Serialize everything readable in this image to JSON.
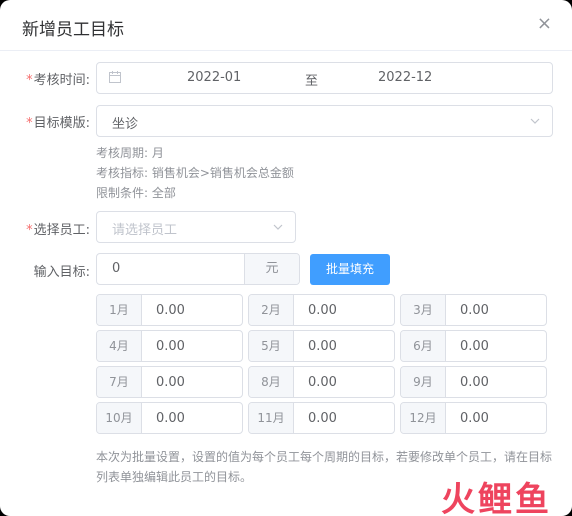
{
  "dialog": {
    "title": "新增员工目标",
    "close_symbol": "×"
  },
  "form": {
    "period": {
      "label": "考核时间:",
      "required_mark": "*",
      "start": "2022-01",
      "separator": "至",
      "end": "2022-12"
    },
    "template": {
      "label": "目标模版:",
      "required_mark": "*",
      "value": "坐诊"
    },
    "info": {
      "cycle_label": "考核周期:",
      "cycle_value": "月",
      "metric_label": "考核指标:",
      "metric_value": "销售机会>销售机会总金额",
      "limit_label": "限制条件:",
      "limit_value": "全部"
    },
    "employee": {
      "label": "选择员工:",
      "required_mark": "*",
      "placeholder": "请选择员工"
    },
    "target": {
      "label": "输入目标:",
      "value": "0",
      "unit": "元",
      "button": "批量填充"
    },
    "months": [
      {
        "label": "1月",
        "value": "0.00"
      },
      {
        "label": "2月",
        "value": "0.00"
      },
      {
        "label": "3月",
        "value": "0.00"
      },
      {
        "label": "4月",
        "value": "0.00"
      },
      {
        "label": "5月",
        "value": "0.00"
      },
      {
        "label": "6月",
        "value": "0.00"
      },
      {
        "label": "7月",
        "value": "0.00"
      },
      {
        "label": "8月",
        "value": "0.00"
      },
      {
        "label": "9月",
        "value": "0.00"
      },
      {
        "label": "10月",
        "value": "0.00"
      },
      {
        "label": "11月",
        "value": "0.00"
      },
      {
        "label": "12月",
        "value": "0.00"
      }
    ],
    "note": "本次为批量设置，设置的值为每个员工每个周期的目标，若要修改单个员工，请在目标列表单独编辑此员工的目标。"
  },
  "watermark": "火鲤鱼",
  "colors": {
    "primary": "#409eff",
    "required": "#f56c6c",
    "watermark": "#ee3a56"
  }
}
